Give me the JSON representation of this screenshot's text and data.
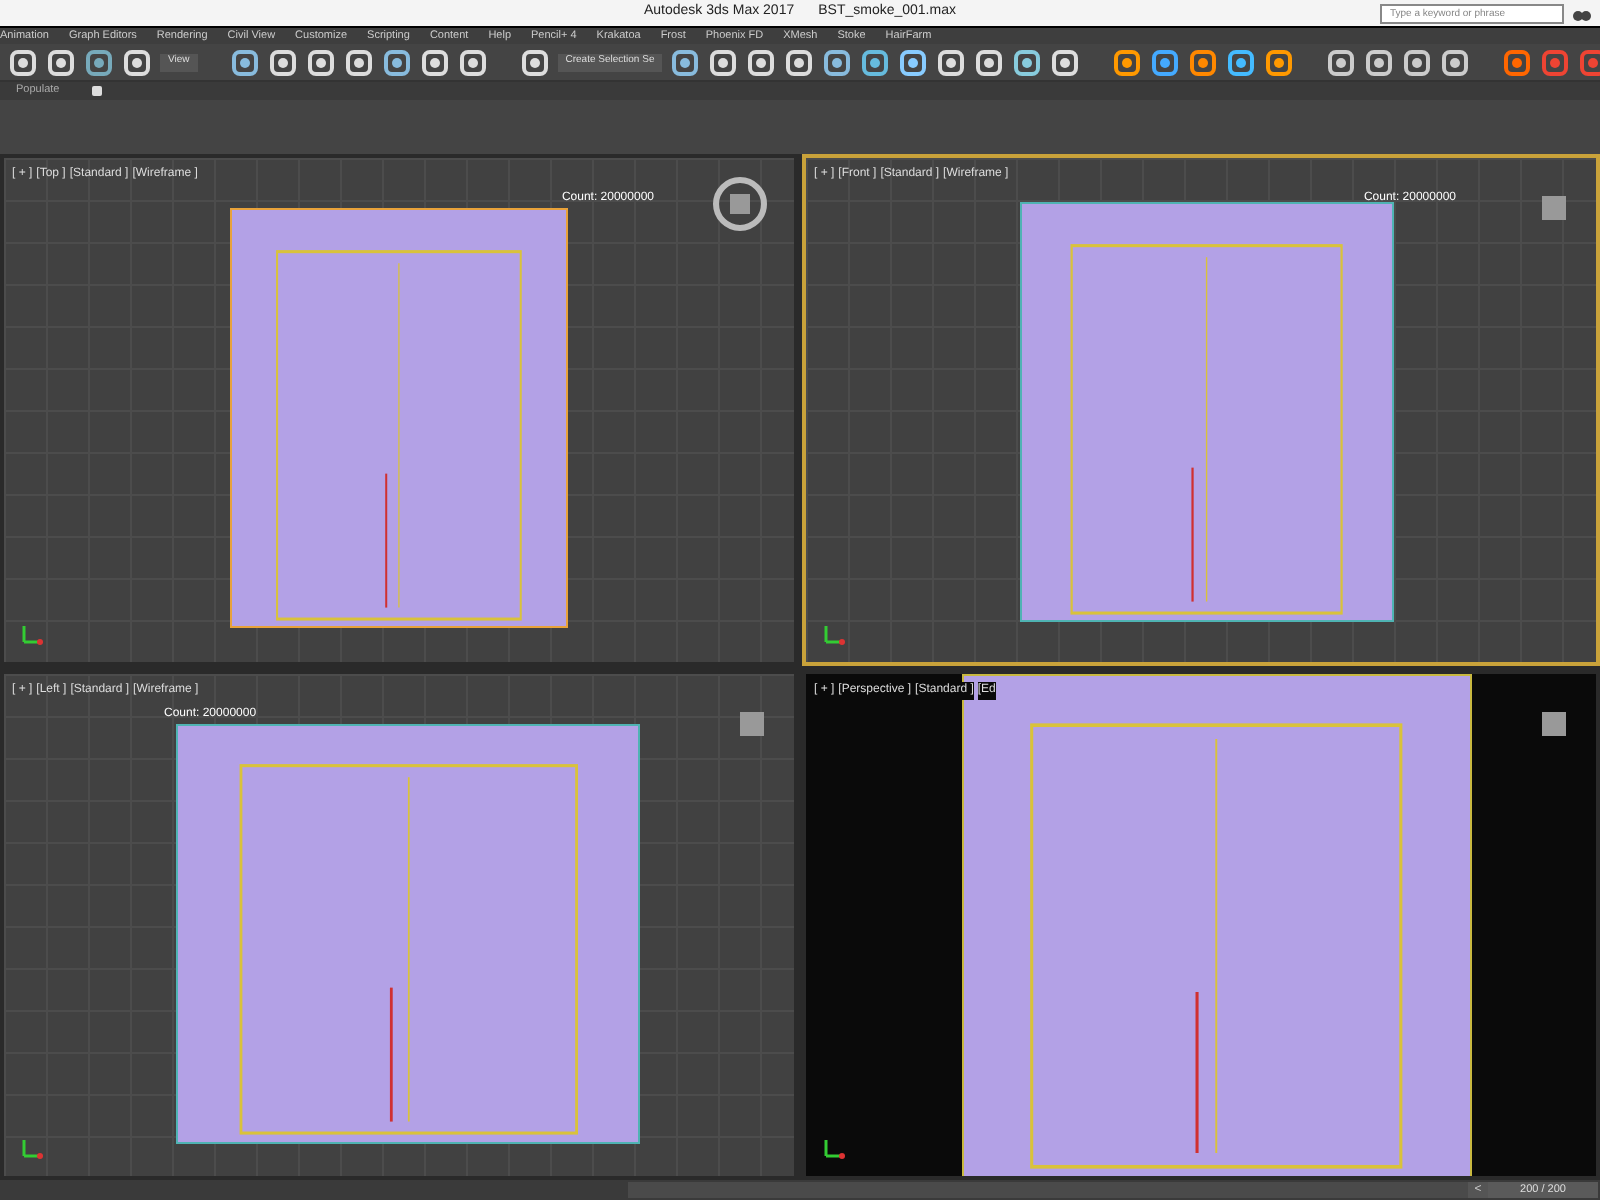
{
  "window": {
    "title": "Autodesk 3ds Max 2017",
    "file": "BST_smoke_001.max"
  },
  "search": {
    "placeholder": "Type a keyword or phrase"
  },
  "menu": [
    "Animation",
    "Graph Editors",
    "Rendering",
    "Civil View",
    "Customize",
    "Scripting",
    "Content",
    "Help",
    "Pencil+ 4",
    "Krakatoa",
    "Frost",
    "Phoenix FD",
    "XMesh",
    "Stoke",
    "HairFarm"
  ],
  "toolbar": {
    "view_dropdown": "View",
    "selection_set": "Create Selection Se"
  },
  "ribbon": {
    "tab": "Populate"
  },
  "viewports": [
    {
      "kind": "top",
      "labels": [
        "[ + ]",
        "[Top ]",
        "[Standard ]",
        "[Wireframe ]"
      ],
      "count": "Count: 20000000",
      "selected": false
    },
    {
      "kind": "front",
      "labels": [
        "[ + ]",
        "[Front ]",
        "[Standard ]",
        "[Wireframe ]"
      ],
      "count": "Count: 20000000",
      "selected": true
    },
    {
      "kind": "left",
      "labels": [
        "[ + ]",
        "[Left ]",
        "[Standard ]",
        "[Wireframe ]"
      ],
      "count": "Count: 20000000",
      "selected": false
    },
    {
      "kind": "perspective",
      "labels": [
        "[ + ]",
        "[Perspective ]",
        "[Standard ]",
        "[Ed"
      ],
      "selected": false
    }
  ],
  "time_slider": {
    "back": "<",
    "reading": "200 / 200",
    "level": 1
  }
}
